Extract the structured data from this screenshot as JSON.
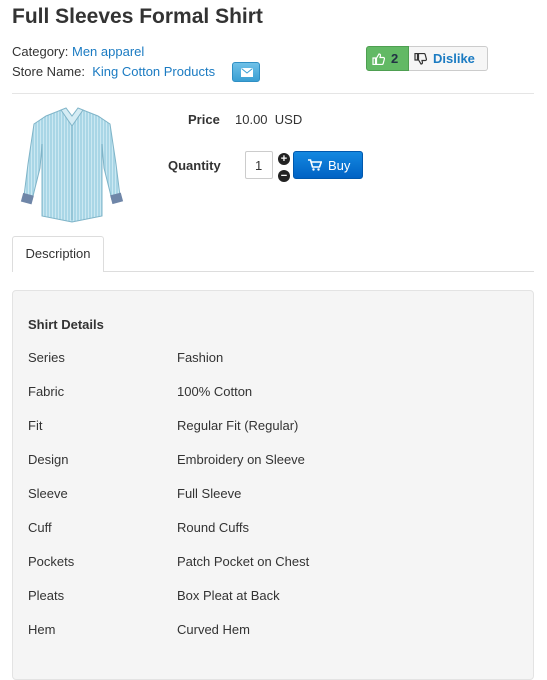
{
  "product": {
    "title": "Full Sleeves Formal Shirt",
    "category_label": "Category:",
    "category_value": "Men apparel",
    "store_label": "Store Name:",
    "store_value": "King Cotton Products"
  },
  "votes": {
    "like_count": "2",
    "dislike_label": "Dislike"
  },
  "purchase": {
    "price_label": "Price",
    "price_value": "10.00",
    "currency": "USD",
    "quantity_label": "Quantity",
    "quantity_value": "1",
    "buy_label": "Buy"
  },
  "tabs": {
    "description": "Description"
  },
  "details": {
    "heading": "Shirt Details",
    "rows": [
      {
        "key": "Series",
        "value": "Fashion"
      },
      {
        "key": "Fabric",
        "value": "100% Cotton"
      },
      {
        "key": "Fit",
        "value": "Regular Fit (Regular)"
      },
      {
        "key": "Design",
        "value": "Embroidery on Sleeve"
      },
      {
        "key": "Sleeve",
        "value": "Full Sleeve"
      },
      {
        "key": "Cuff",
        "value": "Round Cuffs"
      },
      {
        "key": "Pockets",
        "value": "Patch Pocket on Chest"
      },
      {
        "key": "Pleats",
        "value": "Box Pleat at Back"
      },
      {
        "key": "Hem",
        "value": "Curved Hem"
      }
    ]
  },
  "colors": {
    "link": "#1b7bc2",
    "like_green": "#62b965",
    "buy_blue": "#0a74d6"
  },
  "icons": [
    "mail-icon",
    "thumbs-up-icon",
    "thumbs-down-icon",
    "cart-icon",
    "plus-icon",
    "minus-icon"
  ]
}
